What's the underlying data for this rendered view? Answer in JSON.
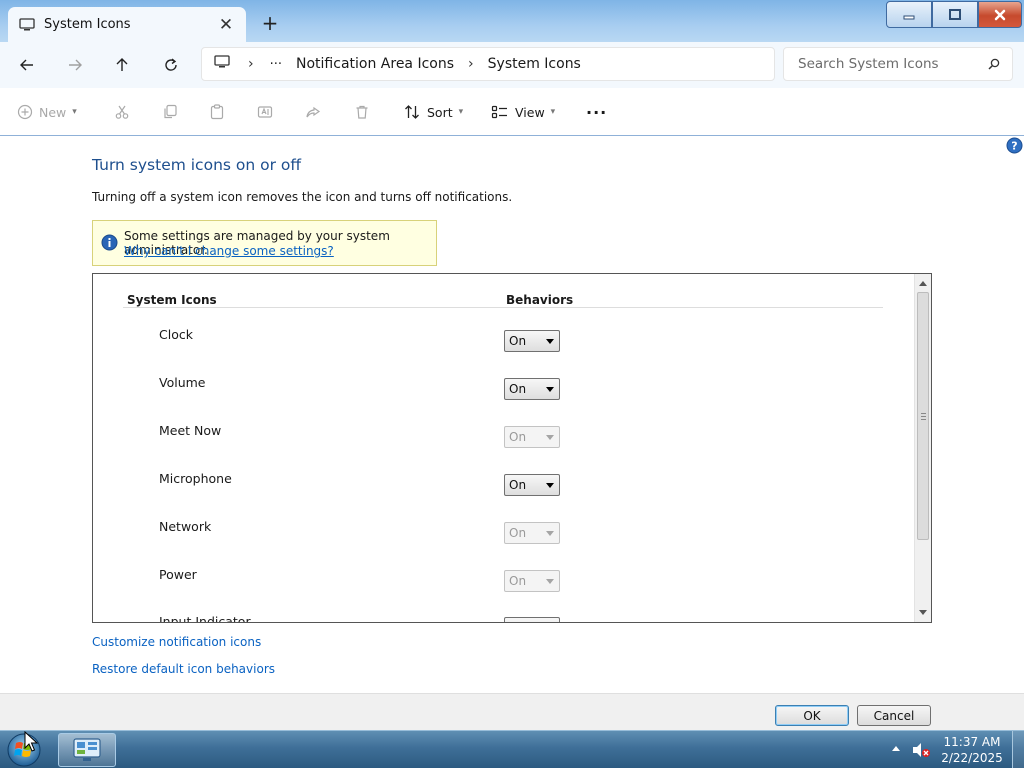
{
  "window": {
    "tab_title": "System Icons",
    "close_glyph": "✕",
    "new_tab_glyph": "+"
  },
  "address": {
    "more_glyph": "···",
    "crumbs": [
      "Notification Area Icons",
      "System Icons"
    ],
    "search_placeholder": "Search System Icons"
  },
  "commands": {
    "new_label": "New",
    "sort_label": "Sort",
    "view_label": "View",
    "more_glyph": "···"
  },
  "content": {
    "title": "Turn system icons on or off",
    "description": "Turning off a system icon removes the icon and turns off notifications.",
    "info_message": "Some settings are managed by your system administrator.",
    "info_link": "Why can't I change some settings?",
    "col_icons": "System Icons",
    "col_behaviors": "Behaviors",
    "rows": [
      {
        "name": "Clock",
        "value": "On",
        "enabled": true
      },
      {
        "name": "Volume",
        "value": "On",
        "enabled": true
      },
      {
        "name": "Meet Now",
        "value": "On",
        "enabled": false
      },
      {
        "name": "Microphone",
        "value": "On",
        "enabled": true
      },
      {
        "name": "Network",
        "value": "On",
        "enabled": false
      },
      {
        "name": "Power",
        "value": "On",
        "enabled": false
      },
      {
        "name": "Input Indicator",
        "value": "",
        "enabled": true
      }
    ],
    "link_customize": "Customize notification icons",
    "link_restore": "Restore default icon behaviors"
  },
  "footer": {
    "ok_label": "OK",
    "cancel_label": "Cancel"
  },
  "taskbar": {
    "time": "11:37 AM",
    "date": "2/22/2025"
  },
  "colors": {
    "accent_link": "#0a62c2",
    "title_blue": "#1e4f8e",
    "info_bg": "#ffffe1"
  }
}
